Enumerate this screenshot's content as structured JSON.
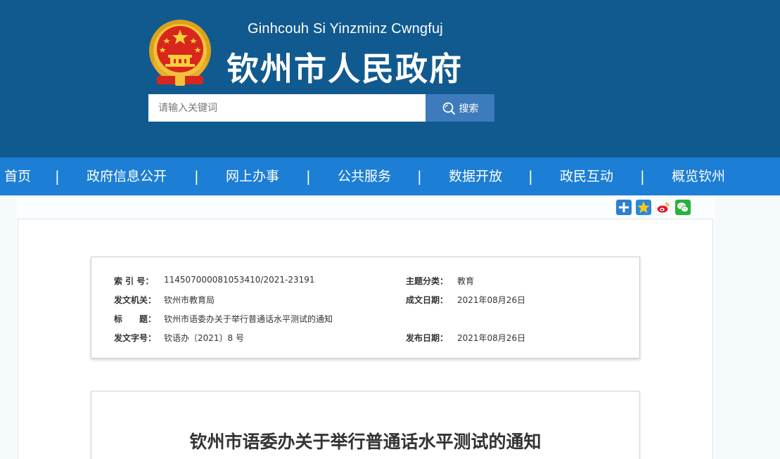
{
  "header": {
    "subtitle": "Ginhcouh Si Yinzminz Cwngfuj",
    "title": "钦州市人民政府",
    "emblem_icon": "national-emblem-icon",
    "background_color": "#115a8f"
  },
  "search": {
    "placeholder": "请输入关键词",
    "value": "",
    "button_label": "搜索",
    "button_icon": "search-icon",
    "button_color": "#3d7bbd"
  },
  "nav": {
    "background_color": "#1c7ed4",
    "separator": "|",
    "items": [
      {
        "label": "首页"
      },
      {
        "label": "政府信息公开"
      },
      {
        "label": "网上办事"
      },
      {
        "label": "公共服务"
      },
      {
        "label": "数据开放"
      },
      {
        "label": "政民互动"
      },
      {
        "label": "概览钦州"
      }
    ]
  },
  "share": {
    "icons": [
      "share-plus-icon",
      "qzone-star-icon",
      "weibo-icon",
      "wechat-icon"
    ]
  },
  "info": {
    "index_label": "索 引 号：",
    "index_value": "114507000081053410/2021-23191",
    "topic_label": "主题分类：",
    "topic_value": "教育",
    "issuer_label": "发文机关：",
    "issuer_value": "钦州市教育局",
    "created_label": "成文日期：",
    "created_value": "2021年08月26日",
    "title_label": "标　　题：",
    "title_value": "钦州市语委办关于举行普通话水平测试的通知",
    "docno_label": "发文字号：",
    "docno_value": "钦语办〔2021〕8 号",
    "published_label": "发布日期：",
    "published_value": "2021年08月26日"
  },
  "article": {
    "title": "钦州市语委办关于举行普通话水平测试的通知"
  }
}
